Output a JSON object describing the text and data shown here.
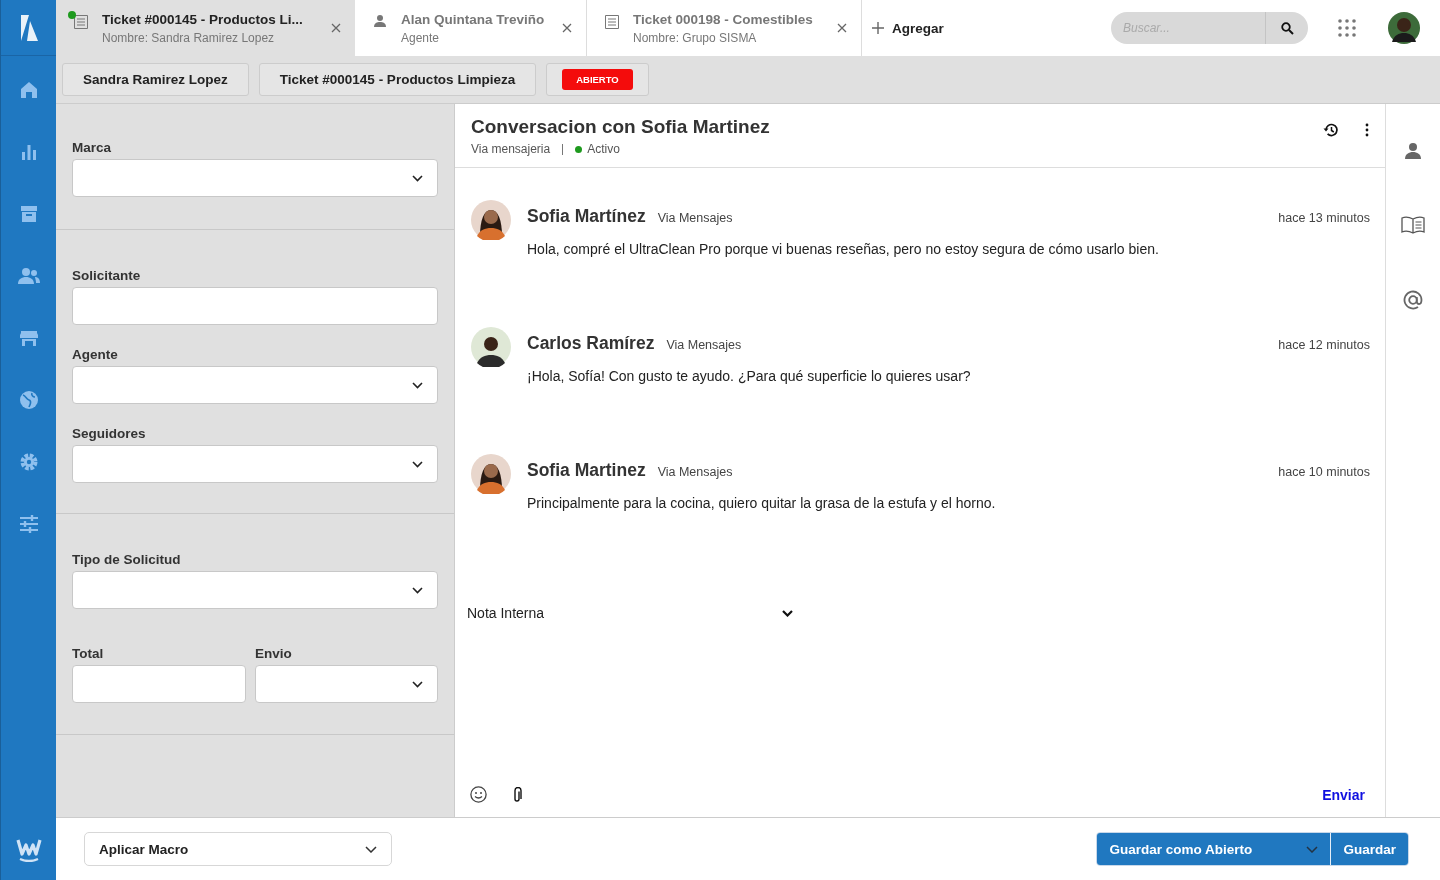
{
  "tabs": [
    {
      "kind": "ticket",
      "title": "Ticket #000145 - Productos Li...",
      "subtitle": "Nombre: Sandra Ramirez Lopez",
      "selected": true,
      "color": "#1e9a1e"
    },
    {
      "kind": "person",
      "title": "Alan Quintana Treviño",
      "subtitle": "Agente",
      "selected": false
    },
    {
      "kind": "ticket",
      "title": "Ticket 000198 - Comestibles",
      "subtitle": "Nombre: Grupo SISMA",
      "selected": false
    }
  ],
  "add_tab": "Agregar",
  "search": {
    "placeholder": "Buscar..."
  },
  "breadcrumbs": [
    "Sandra Ramirez Lopez",
    "Ticket #000145 - Productos Limpieza"
  ],
  "status_badge": "ABIERTO",
  "form_sections": [
    [
      {
        "label": "Marca",
        "kind": "select"
      }
    ],
    [
      {
        "label": "Solicitante",
        "kind": "text"
      },
      {
        "label": "Agente",
        "kind": "select"
      },
      {
        "label": "Seguidores",
        "kind": "select"
      }
    ],
    [
      {
        "label": "Tipo de Solicitud",
        "kind": "select"
      },
      {
        "row": [
          {
            "label": "Total",
            "kind": "text"
          },
          {
            "label": "Envio",
            "kind": "select"
          }
        ]
      }
    ]
  ],
  "conversation": {
    "title": "Conversacion con Sofia Martinez",
    "channel": "Via mensajeria",
    "status": "Activo"
  },
  "messages": [
    {
      "author": "Sofia Martínez",
      "via": "Via Mensajes",
      "time": "hace 13 minutos",
      "text": "Hola, compré el UltraClean Pro porque vi buenas reseñas, pero no estoy segura de cómo usarlo bien.",
      "kind": "woman"
    },
    {
      "author": "Carlos Ramírez",
      "via": "Via Mensajes",
      "time": "hace 12 minutos",
      "text": "¡Hola, Sofía! Con gusto te ayudo. ¿Para qué superficie lo quieres usar?",
      "kind": "man"
    },
    {
      "author": "Sofia Martinez",
      "via": "Via Mensajes",
      "time": "hace 10 minutos",
      "text": "Principalmente para la cocina, quiero quitar la grasa de la estufa y el horno.",
      "kind": "woman"
    }
  ],
  "composer": {
    "mode": "Nota Interna",
    "send": "Enviar"
  },
  "macro": "Aplicar Macro",
  "save_as": "Guardar como Abierto",
  "save": "Guardar"
}
